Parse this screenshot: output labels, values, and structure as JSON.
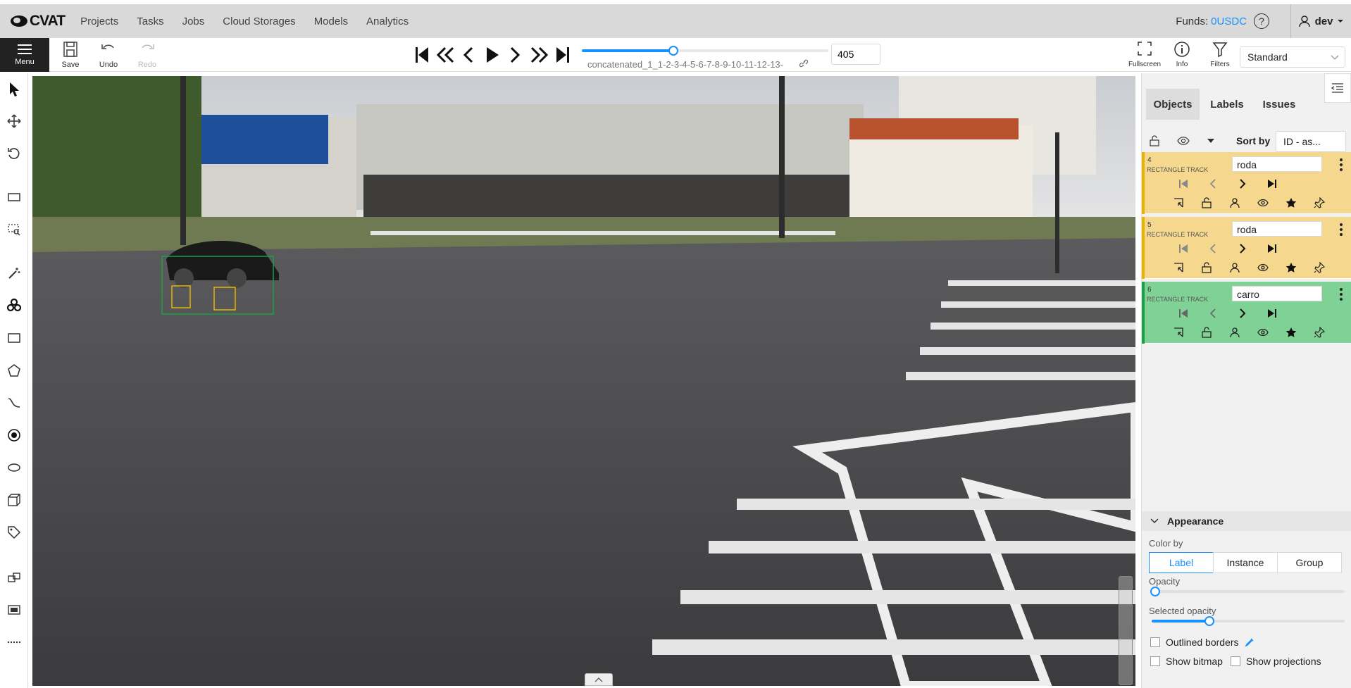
{
  "header": {
    "logo_text": "CVAT",
    "nav": [
      "Projects",
      "Tasks",
      "Jobs",
      "Cloud Storages",
      "Models",
      "Analytics"
    ],
    "funds_label": "Funds:",
    "funds_amount": "0USDC",
    "user": "dev"
  },
  "toolbar": {
    "menu_label": "Menu",
    "save_label": "Save",
    "undo_label": "Undo",
    "redo_label": "Redo",
    "filename": "concatenated_1_1-2-3-4-5-6-7-8-9-10-11-12-13-",
    "frame_number": "405",
    "frame_progress": 0.37,
    "fullscreen_label": "Fullscreen",
    "info_label": "Info",
    "filters_label": "Filters",
    "workspace": "Standard"
  },
  "sidebar": {
    "tabs": [
      "Objects",
      "Labels",
      "Issues"
    ],
    "sort_label": "Sort by",
    "sort_value": "ID - as...",
    "objects": [
      {
        "id": "4",
        "type": "RECTANGLE TRACK",
        "label": "roda",
        "color": "#f5d78e",
        "bar": "#e8b400"
      },
      {
        "id": "5",
        "type": "RECTANGLE TRACK",
        "label": "roda",
        "color": "#f5d78e",
        "bar": "#e8b400"
      },
      {
        "id": "6",
        "type": "RECTANGLE TRACK",
        "label": "carro",
        "color": "#7fd195",
        "bar": "#1aa046"
      }
    ]
  },
  "appearance": {
    "title": "Appearance",
    "color_by_label": "Color by",
    "color_by_options": [
      "Label",
      "Instance",
      "Group"
    ],
    "color_by_selected": "Label",
    "opacity_label": "Opacity",
    "opacity_value": 0.0,
    "selected_opacity_label": "Selected opacity",
    "selected_opacity_value": 0.3,
    "outlined_borders_label": "Outlined borders",
    "show_bitmap_label": "Show bitmap",
    "show_projections_label": "Show projections"
  },
  "colors": {
    "accent": "#1890ff",
    "box_car": "#1aa046",
    "box_wheel": "#e8b400"
  }
}
